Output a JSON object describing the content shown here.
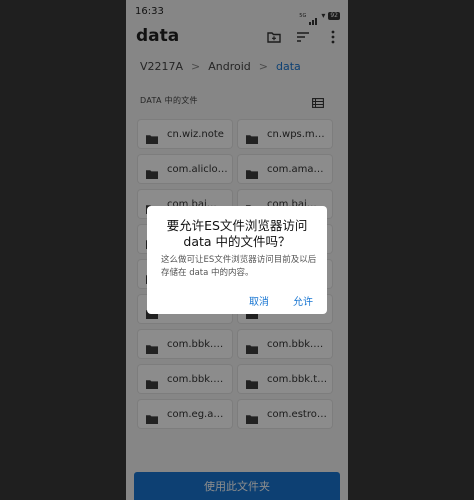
{
  "status_bar": {
    "time": "16:33",
    "signal_text": "5G",
    "battery": "92"
  },
  "header": {
    "title": "data",
    "icons": [
      "new-folder-icon",
      "sort-icon",
      "more-vert-icon"
    ]
  },
  "breadcrumb": {
    "items": [
      "V2217A",
      "Android",
      "data"
    ],
    "separator": ">"
  },
  "section": {
    "title": "DATA 中的文件",
    "view_icon": "list-view-icon"
  },
  "folders": [
    "cn.wiz.note",
    "cn.wps.m…",
    "com.aliclo…",
    "com.ama…",
    "com.bai…",
    "com.bai…",
    "com.bai…",
    "com.bai…",
    "com.bai…",
    "com.bai…",
    "com.baid…",
    "com.baid…",
    "com.bbk.…",
    "com.bbk.…",
    "com.bbk.…",
    "com.bbk.t…",
    "com.eg.a…",
    "com.estro…"
  ],
  "bottom_button": {
    "label": "使用此文件夹"
  },
  "dialog": {
    "title": "要允许ES文件浏览器访问 data 中的文件吗？",
    "body": "这么做可让ES文件浏览器访问目前及以后存储在 data 中的内容。",
    "cancel": "取消",
    "allow": "允许"
  },
  "colors": {
    "accent": "#1976d2",
    "folder": "#3c3c3c"
  }
}
